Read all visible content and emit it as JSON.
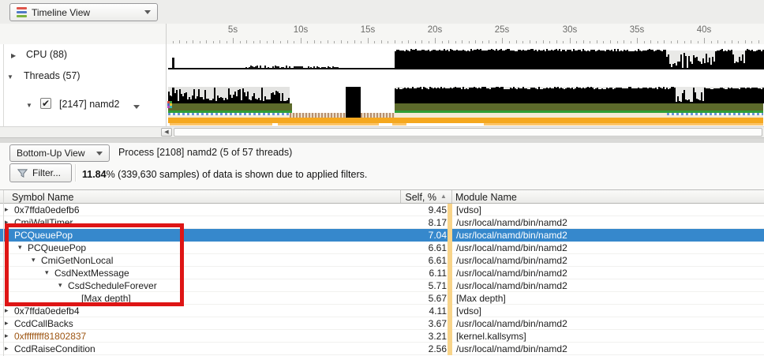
{
  "top_toolbar": {
    "view_selector_label": "Timeline View"
  },
  "timeline": {
    "ruler": {
      "tick_labels": [
        "5s",
        "10s",
        "15s",
        "20s",
        "25s",
        "30s",
        "35s",
        "40s"
      ],
      "tick_interval_s": 5,
      "minor_interval_s": 0.5,
      "end_s": 44.4
    },
    "left_rows": {
      "cpu": {
        "label": "CPU (88)",
        "state": "collapsed"
      },
      "threads": {
        "label": "Threads (57)",
        "state": "expanded"
      },
      "thread": {
        "label": "[2147] namd2",
        "state": "expanded",
        "checked": true
      }
    },
    "cpu_activity": {
      "idle_line": [
        0,
        17
      ],
      "spike_s": 0.45,
      "noise": [
        5.9,
        12.9
      ],
      "busy": [
        [
          17,
          44.4
        ]
      ],
      "dips": [
        [
          37.1,
          40.7
        ],
        [
          42.0,
          43.0
        ]
      ]
    },
    "thread_activity": {
      "bars": [
        [
          0.2,
          9.2
        ]
      ],
      "spike_s": 0.45,
      "idle": [
        [
          9.2,
          13.35
        ],
        [
          14.45,
          17.0
        ]
      ],
      "block": [
        [
          13.35,
          14.45
        ]
      ],
      "busy": [
        [
          17,
          44.4
        ]
      ],
      "busy_dips": [
        [
          37.8,
          39.9
        ]
      ],
      "active_bands": [
        [
          0.2,
          9.4
        ],
        [
          13.35,
          14.45
        ],
        [
          17,
          44.4
        ]
      ],
      "blue_dash": [
        [
          0.2,
          9.2
        ],
        [
          37.2,
          44.4
        ]
      ],
      "orange": [
        [
          0.2,
          44.4
        ]
      ],
      "light_strips": [
        [
          0.3,
          7.9
        ],
        [
          8.3,
          15.8
        ],
        [
          16.8,
          17.9
        ],
        [
          23.6,
          44.4
        ]
      ]
    }
  },
  "scrollbar": {
    "left_arrow": "◀"
  },
  "bottom_toolbar": {
    "view_selector_label": "Bottom-Up View",
    "process_label": "Process [2108] namd2 (5 of 57 threads)",
    "filter_button_label": "Filter...",
    "stats_bold": "11.84",
    "stats_rest": "% (339,630 samples) of data is shown due to applied filters."
  },
  "table": {
    "columns": {
      "symbol": "Symbol Name",
      "self": "Self, %",
      "module": "Module Name"
    },
    "sort": {
      "column": "Self, %",
      "indicator": "▲"
    },
    "rows": [
      {
        "indent": 0,
        "expand": "collapsed",
        "symbol": "0x7ffda0edefb6",
        "self": "9.45",
        "module": "[vdso]"
      },
      {
        "indent": 0,
        "expand": "collapsed",
        "symbol": "CmiWallTimer",
        "self": "8.17",
        "module": "/usr/local/namd/bin/namd2"
      },
      {
        "indent": 0,
        "expand": "expanded",
        "symbol": "PCQueuePop",
        "self": "7.04",
        "module": "/usr/local/namd/bin/namd2",
        "selected": true
      },
      {
        "indent": 1,
        "expand": "expanded",
        "symbol": "PCQueuePop",
        "self": "6.61",
        "module": "/usr/local/namd/bin/namd2"
      },
      {
        "indent": 2,
        "expand": "expanded",
        "symbol": "CmiGetNonLocal",
        "self": "6.61",
        "module": "/usr/local/namd/bin/namd2"
      },
      {
        "indent": 3,
        "expand": "expanded",
        "symbol": "CsdNextMessage",
        "self": "6.11",
        "module": "/usr/local/namd/bin/namd2"
      },
      {
        "indent": 4,
        "expand": "expanded",
        "symbol": "CsdScheduleForever",
        "self": "5.71",
        "module": "/usr/local/namd/bin/namd2"
      },
      {
        "indent": 5,
        "expand": "none",
        "symbol": "[Max depth]",
        "self": "5.67",
        "module": "[Max depth]"
      },
      {
        "indent": 0,
        "expand": "collapsed",
        "symbol": "0x7ffda0edefb4",
        "self": "4.11",
        "module": "[vdso]"
      },
      {
        "indent": 0,
        "expand": "collapsed",
        "symbol": "CcdCallBacks",
        "self": "3.67",
        "module": "/usr/local/namd/bin/namd2"
      },
      {
        "indent": 0,
        "expand": "collapsed",
        "symbol": "0xffffffff81802837",
        "self": "3.21",
        "module": "[kernel.kallsyms]",
        "tone": "kernel"
      },
      {
        "indent": 0,
        "expand": "collapsed",
        "symbol": "CcdRaiseCondition",
        "self": "2.56",
        "module": "/usr/local/namd/bin/namd2"
      }
    ]
  },
  "annotation": {
    "type": "red-highlight-box"
  },
  "colors": {
    "selection_blue": "#3688cc",
    "self_bar_yellow": "#f8d48a",
    "annotation_red": "#de1515",
    "kernel_symbol_text": "#9d5512",
    "band_olive": "#5c6a2b",
    "band_green": "#2f9e36",
    "band_cream": "#f4ead6",
    "band_orange": "#f5a81f",
    "band_light_orange": "#fbc56b",
    "band_blue_dash": "#6b95d6",
    "band_brown_dot": "#b78f6f",
    "icon_red": "#df564b",
    "icon_blue": "#5079c7",
    "icon_green": "#7cb23e"
  }
}
